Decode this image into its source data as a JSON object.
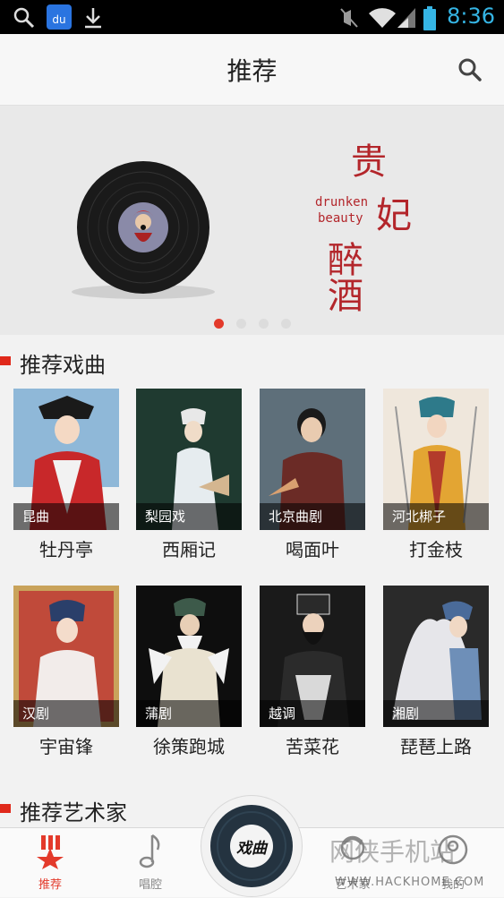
{
  "status_bar": {
    "time": "8:36",
    "icons": [
      "search-icon",
      "baidu-app-icon",
      "download-icon",
      "mute-icon",
      "wifi-icon",
      "signal-icon",
      "battery-icon"
    ],
    "baidu_label": "du",
    "time_color": "#35b5e5"
  },
  "header": {
    "title": "推荐",
    "search_icon": "search-icon"
  },
  "banner": {
    "title_chars": [
      "贵",
      "妃",
      "醉",
      "酒"
    ],
    "subtitle_line1": "drunken",
    "subtitle_line2": "beauty",
    "page_count": 4,
    "active_page": 0
  },
  "section_opera": {
    "title": "推荐戏曲",
    "items": [
      {
        "genre": "昆曲",
        "name": "牡丹亭"
      },
      {
        "genre": "梨园戏",
        "name": "西厢记"
      },
      {
        "genre": "北京曲剧",
        "name": "喝面叶"
      },
      {
        "genre": "河北梆子",
        "name": "打金枝"
      },
      {
        "genre": "汉剧",
        "name": "宇宙锋"
      },
      {
        "genre": "蒲剧",
        "name": "徐策跑城"
      },
      {
        "genre": "越调",
        "name": "苦菜花"
      },
      {
        "genre": "湘剧",
        "name": "琵琶上路"
      }
    ]
  },
  "section_artists": {
    "title": "推荐艺术家"
  },
  "tab_bar": {
    "tabs": [
      {
        "label": "推荐",
        "icon": "star-badge-icon",
        "active": true
      },
      {
        "label": "唱腔",
        "icon": "music-note-icon",
        "active": false
      },
      {
        "label": "艺术家",
        "icon": "artist-icon",
        "active": false
      },
      {
        "label": "我的",
        "icon": "profile-icon",
        "active": false
      }
    ],
    "center_logo_text": "戏曲",
    "accent": "#e33a2b"
  },
  "watermark": {
    "text": "网侠手机站",
    "url": "WWW.HACKHOME.COM"
  }
}
